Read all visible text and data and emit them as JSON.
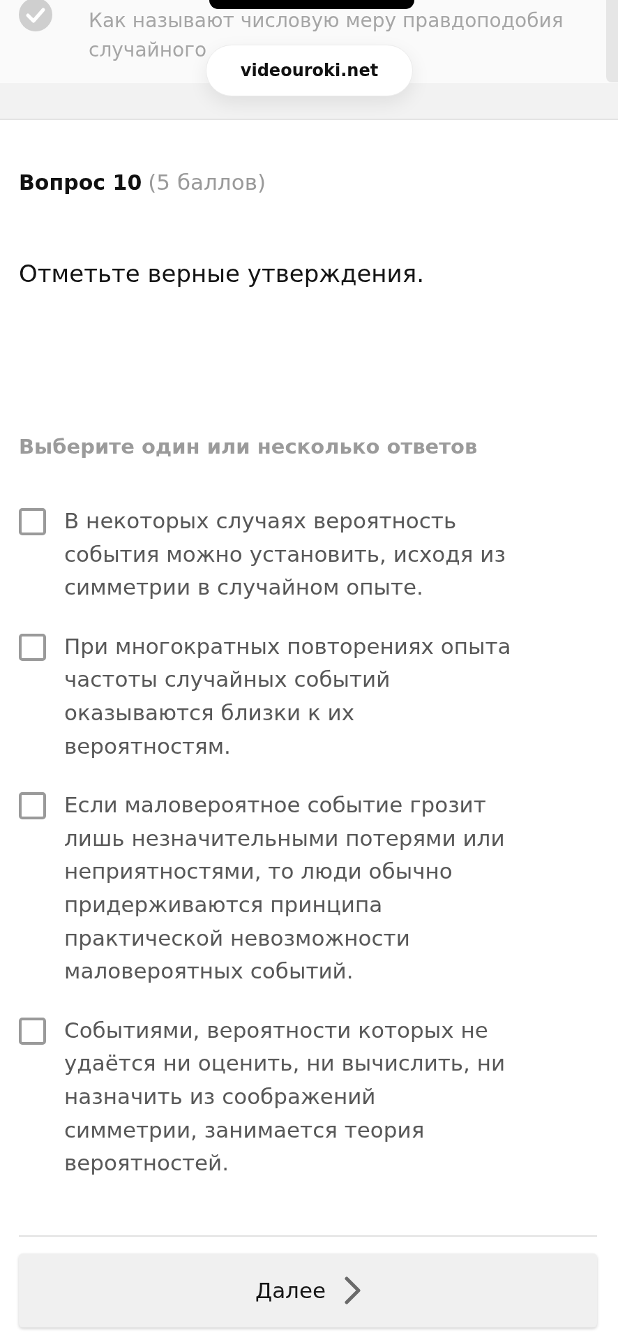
{
  "browser": {
    "address": "videouroki.net"
  },
  "previous_question": {
    "text": "Как называют числовую меру правдоподобия случайного",
    "answered": true
  },
  "question": {
    "title": "Вопрос 10",
    "points": "(5 баллов)",
    "text": "Отметьте верные утверждения.",
    "instruction": "Выберите один или несколько ответов"
  },
  "options": [
    {
      "text": "В некоторых случаях вероятность события можно установить, исходя из симметрии в случайном опыте.",
      "checked": false
    },
    {
      "text": "При многократных повторениях опыта частоты случайных событий оказываются близки к их вероятностям.",
      "checked": false
    },
    {
      "text": "Если маловероятное событие грозит лишь незначительными потерями или неприятностями, то люди обычно придерживаются принципа практической невозможности маловероятных событий.",
      "checked": false
    },
    {
      "text": "Событиями, вероятности которых не удаётся ни оценить, ни вычислить, ни назначить из соображений симметрии, занимается теория вероятностей.",
      "checked": false
    }
  ],
  "next_button": {
    "label": "Далее"
  }
}
